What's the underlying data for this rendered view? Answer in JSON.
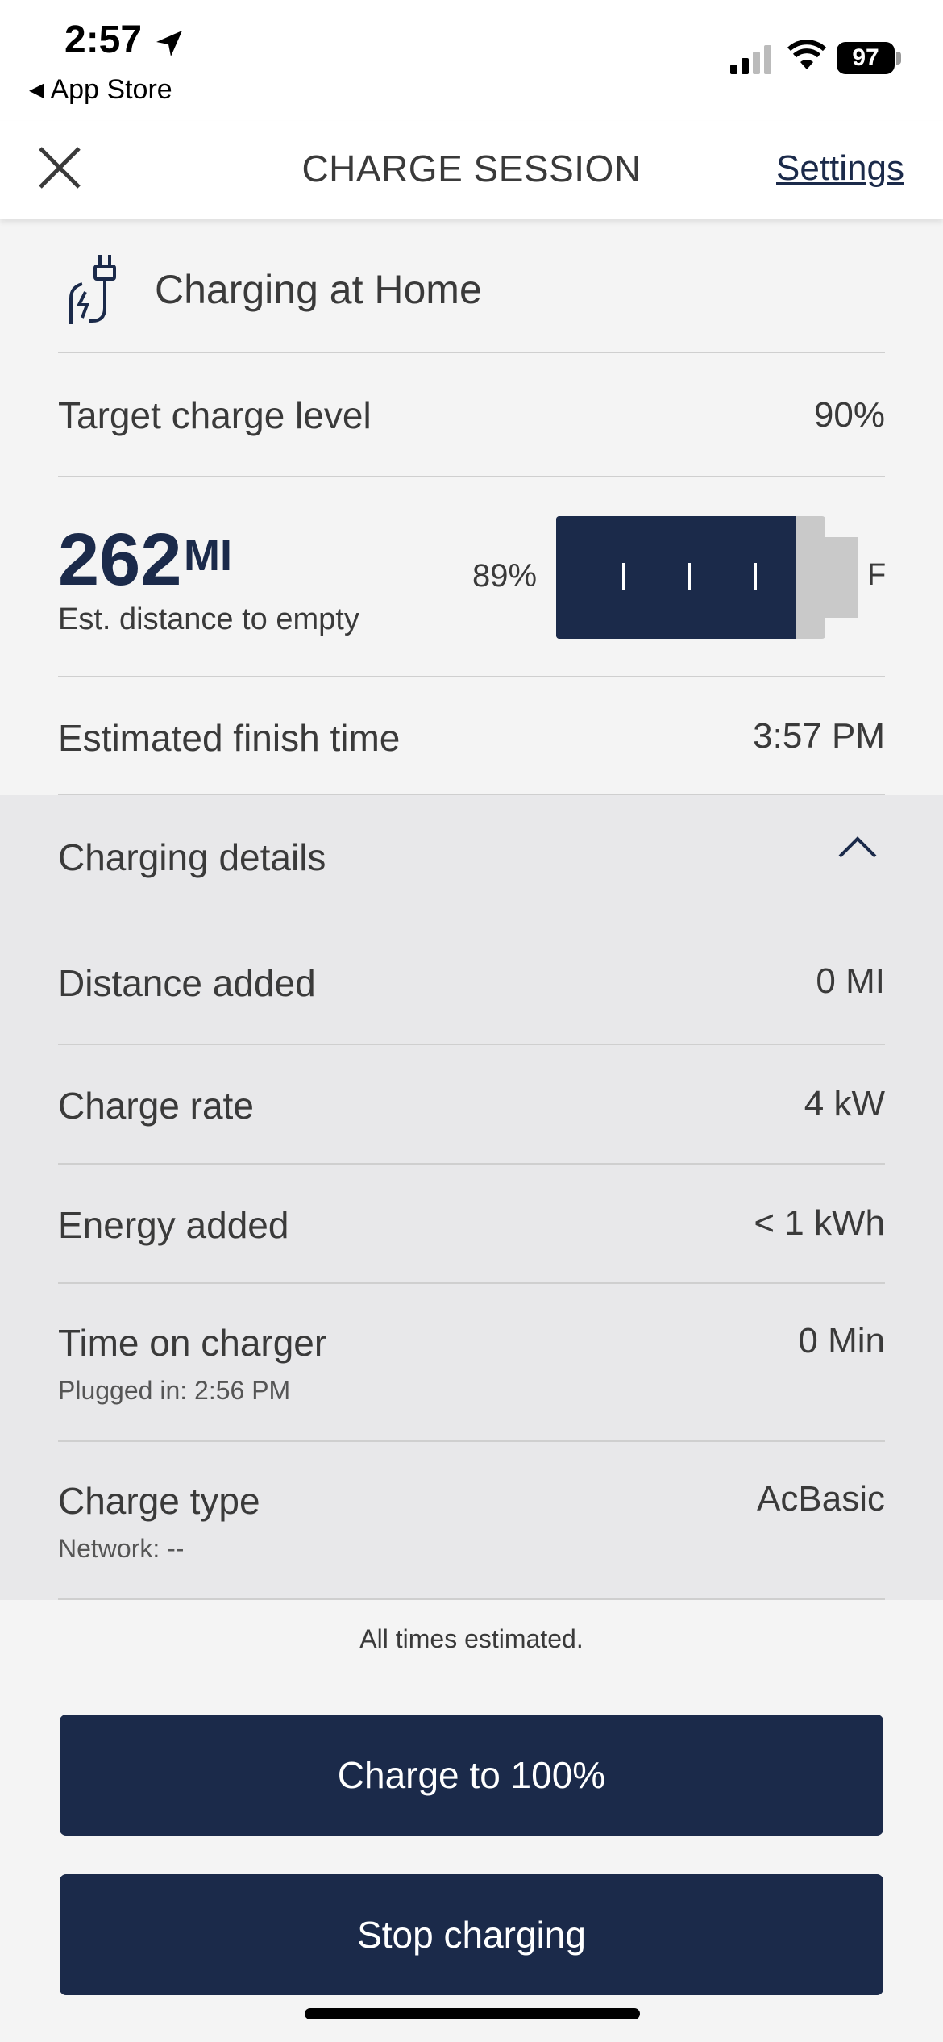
{
  "status_bar": {
    "time": "2:57",
    "back_app": "App Store",
    "battery": "97"
  },
  "header": {
    "title": "CHARGE SESSION",
    "settings_label": "Settings"
  },
  "location": {
    "label": "Charging at Home"
  },
  "target": {
    "label": "Target charge level",
    "value": "90%"
  },
  "range": {
    "value": "262",
    "unit": "MI",
    "label": "Est. distance to empty",
    "battery_percent_label": "89%",
    "battery_level": 0.89,
    "full_marker": "F"
  },
  "finish": {
    "label": "Estimated finish time",
    "value": "3:57 PM"
  },
  "details": {
    "title": "Charging details",
    "rows": [
      {
        "label": "Distance added",
        "value": "0 MI",
        "sub": ""
      },
      {
        "label": "Charge rate",
        "value": "4 kW",
        "sub": ""
      },
      {
        "label": "Energy added",
        "value": "< 1 kWh",
        "sub": ""
      },
      {
        "label": "Time on charger",
        "value": "0 Min",
        "sub": "Plugged in: 2:56 PM"
      },
      {
        "label": "Charge type",
        "value": "AcBasic",
        "sub": "Network: --"
      }
    ]
  },
  "footnote": "All times estimated.",
  "buttons": {
    "charge_full": "Charge to 100%",
    "stop": "Stop charging"
  },
  "colors": {
    "accent": "#1b2a4a",
    "page_bg": "#f4f4f4",
    "details_bg": "#e8e8ea"
  }
}
